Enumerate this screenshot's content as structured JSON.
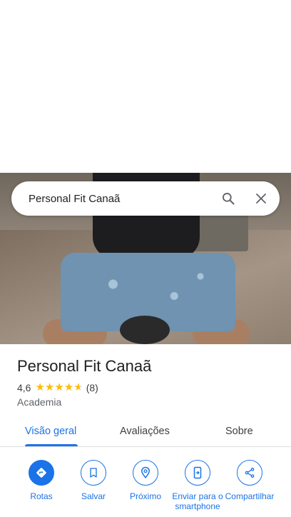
{
  "search": {
    "query": "Personal Fit Canaã"
  },
  "place": {
    "name": "Personal Fit Canaã",
    "rating": "4,6",
    "rating_value": 4.6,
    "stars": 5,
    "reviews": "(8)",
    "category": "Academia"
  },
  "tabs": [
    {
      "label": "Visão geral",
      "active": true
    },
    {
      "label": "Avaliações",
      "active": false
    },
    {
      "label": "Sobre",
      "active": false
    }
  ],
  "actions": [
    {
      "label": "Rotas",
      "icon": "directions-icon"
    },
    {
      "label": "Salvar",
      "icon": "bookmark-icon"
    },
    {
      "label": "Próximo",
      "icon": "nearby-icon"
    },
    {
      "label": "Enviar para o smartphone",
      "icon": "send-to-phone-icon"
    },
    {
      "label": "Compartilhar",
      "icon": "share-icon"
    }
  ],
  "colors": {
    "accent": "#1a73e8",
    "star": "#fbbc04"
  }
}
